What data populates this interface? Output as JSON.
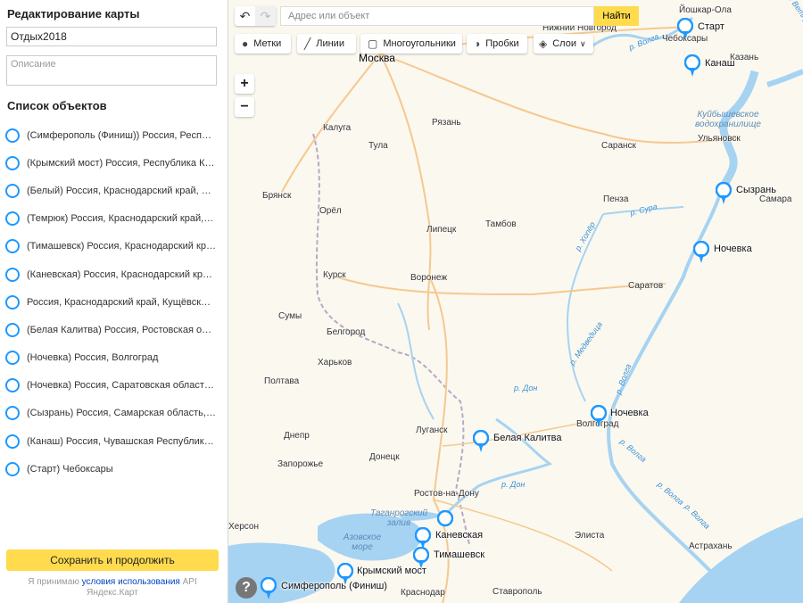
{
  "sidebar": {
    "title": "Редактирование карты",
    "map_name": "Отдых2018",
    "description_placeholder": "Описание",
    "list_title": "Список объектов",
    "objects": [
      "(Симферополь (Финиш)) Россия, Республика Крым, Симферополь",
      "(Крымский мост) Россия, Республика Крым, Керчь",
      "(Белый) Россия, Краснодарский край, Темрюкский район",
      "(Темрюк) Россия, Краснодарский край, Темрюк",
      "(Тимашевск) Россия, Краснодарский край, Тимашевск",
      "(Каневская) Россия, Краснодарский край, Каневская",
      "Россия, Краснодарский край, Кущёвский район",
      "(Белая Калитва) Россия, Ростовская область, Белая Калитва",
      "(Ночевка) Россия, Волгоград",
      "(Ночевка) Россия, Саратовская область, Балаково",
      "(Сызрань) Россия, Самарская область, Сызрань",
      "(Канаш) Россия, Чувашская Республика, Канаш",
      "(Старт) Чебоксары"
    ],
    "save_label": "Сохранить и продолжить",
    "terms_prefix": "Я принимаю ",
    "terms_link": "условия использования",
    "terms_suffix": " API Яндекс.Карт"
  },
  "toolbar": {
    "search_placeholder": "Адрес или объект",
    "search_button": "Найти",
    "tools": [
      "Метки",
      "Линии",
      "Многоугольники",
      "Пробки",
      "Слои"
    ],
    "zoom_in": "+",
    "zoom_out": "−",
    "help": "?"
  },
  "map": {
    "cities": [
      "Москва",
      "Нижний Новгород",
      "Йошкар-Ола",
      "Чебоксары",
      "Казань",
      "Калуга",
      "Рязань",
      "Тула",
      "Саранск",
      "Ульяновск",
      "Брянск",
      "Орёл",
      "Пенза",
      "Самара",
      "Липецк",
      "Тамбов",
      "Курск",
      "Воронеж",
      "Саратов",
      "Сумы",
      "Белгород",
      "Харьков",
      "Полтава",
      "Волгоград",
      "Луганск",
      "Днепр",
      "Запорожье",
      "Донецк",
      "Ростов-на-Дону",
      "Элиста",
      "Херсон",
      "Астрахань",
      "Краснодар",
      "Ставрополь"
    ],
    "rivers": [
      "р. Волга",
      "р. Ветлуга",
      "р. Хопёр",
      "р. Сура",
      "р. Медведица",
      "р. Дон",
      "р. Дон",
      "р. Волга",
      "р. Волга",
      "р. Волга",
      "р. Волга"
    ],
    "seas": [
      "Куйбышевское водохранилище",
      "Таганрогский залив",
      "Азовское море"
    ],
    "markers": [
      "Старт",
      "Канаш",
      "Сызрань",
      "Ночевка",
      "Ночевка",
      "Белая Калитва",
      "Каневская",
      "Тимашевск",
      "Крымский мост",
      "Симферополь (Финиш)",
      ""
    ]
  },
  "colors": {
    "accent": "#1e98ff",
    "button": "#ffdb4d",
    "land": "#fbf8ef",
    "water": "#a6d3f2",
    "road": "#f5c890"
  }
}
